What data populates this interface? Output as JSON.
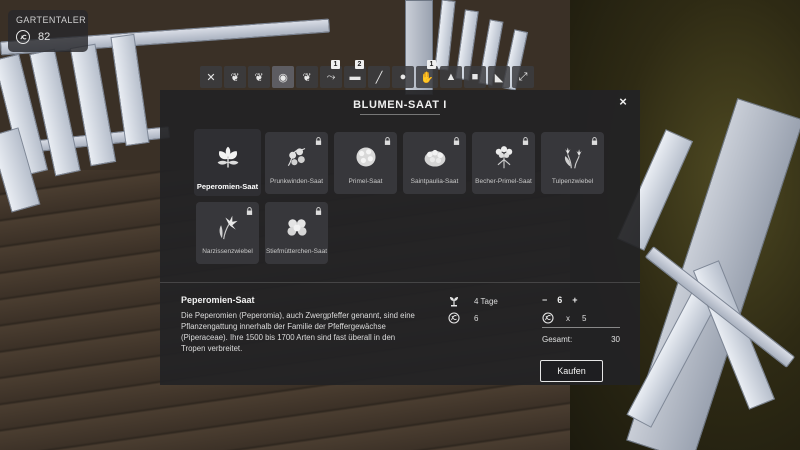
{
  "wallet": {
    "title": "GARTENTALER",
    "amount": "82",
    "icon": "coin-icon"
  },
  "tabs": [
    {
      "icon": "tools-icon",
      "badge": ""
    },
    {
      "icon": "seed-icon",
      "badge": ""
    },
    {
      "icon": "seed-icon",
      "badge": ""
    },
    {
      "icon": "eye-seed-icon",
      "badge": "",
      "active": true
    },
    {
      "icon": "seed-icon",
      "badge": ""
    },
    {
      "icon": "watering-icon",
      "badge": "1"
    },
    {
      "icon": "shelf-icon",
      "badge": "2"
    },
    {
      "icon": "shovel-icon",
      "badge": ""
    },
    {
      "icon": "bag-icon",
      "badge": ""
    },
    {
      "icon": "hand-icon",
      "badge": "1"
    },
    {
      "icon": "fertilizer-icon",
      "badge": ""
    },
    {
      "icon": "box-icon",
      "badge": ""
    },
    {
      "icon": "wheelbarrow-icon",
      "badge": ""
    },
    {
      "icon": "expand-icon",
      "badge": ""
    }
  ],
  "dialog": {
    "title": "BLUMEN-SAAT I",
    "close_label": "×"
  },
  "seeds": [
    {
      "label": "Peperomien-Saat",
      "locked": false,
      "selected": true,
      "icon": "leaves-icon"
    },
    {
      "label": "Prunkwinden-Saat",
      "locked": true,
      "selected": false,
      "icon": "morning-glory-icon"
    },
    {
      "label": "Primel-Saat",
      "locked": true,
      "selected": false,
      "icon": "primrose-icon"
    },
    {
      "label": "Saintpaulia-Saat",
      "locked": true,
      "selected": false,
      "icon": "african-violet-icon"
    },
    {
      "label": "Becher-Primel-Saat",
      "locked": true,
      "selected": false,
      "icon": "cup-primrose-icon"
    },
    {
      "label": "Tulpenzwiebel",
      "locked": true,
      "selected": false,
      "icon": "tulip-icon"
    },
    {
      "label": "Narzissenzwiebel",
      "locked": true,
      "selected": false,
      "icon": "daffodil-icon"
    },
    {
      "label": "Stiefmütterchen-Saat",
      "locked": true,
      "selected": false,
      "icon": "pansy-icon"
    }
  ],
  "details": {
    "title": "Peperomien-Saat",
    "text": "Die Peperomien (Peperomia), auch Zwergpfeffer genannt, sind eine Pflanzengattung innerhalb der Familie der Pfeffergewächse (Piperaceae). Ihre 1500 bis 1700 Arten sind fast überall in den Tropen verbreitet.",
    "grow_time": "4 Tage",
    "price": "6"
  },
  "purchase": {
    "minus_label": "−",
    "quantity": "6",
    "plus_label": "+",
    "multiply": "x",
    "unit_price": "5",
    "total_label": "Gesamt:",
    "total_value": "30",
    "buy_label": "Kaufen"
  }
}
